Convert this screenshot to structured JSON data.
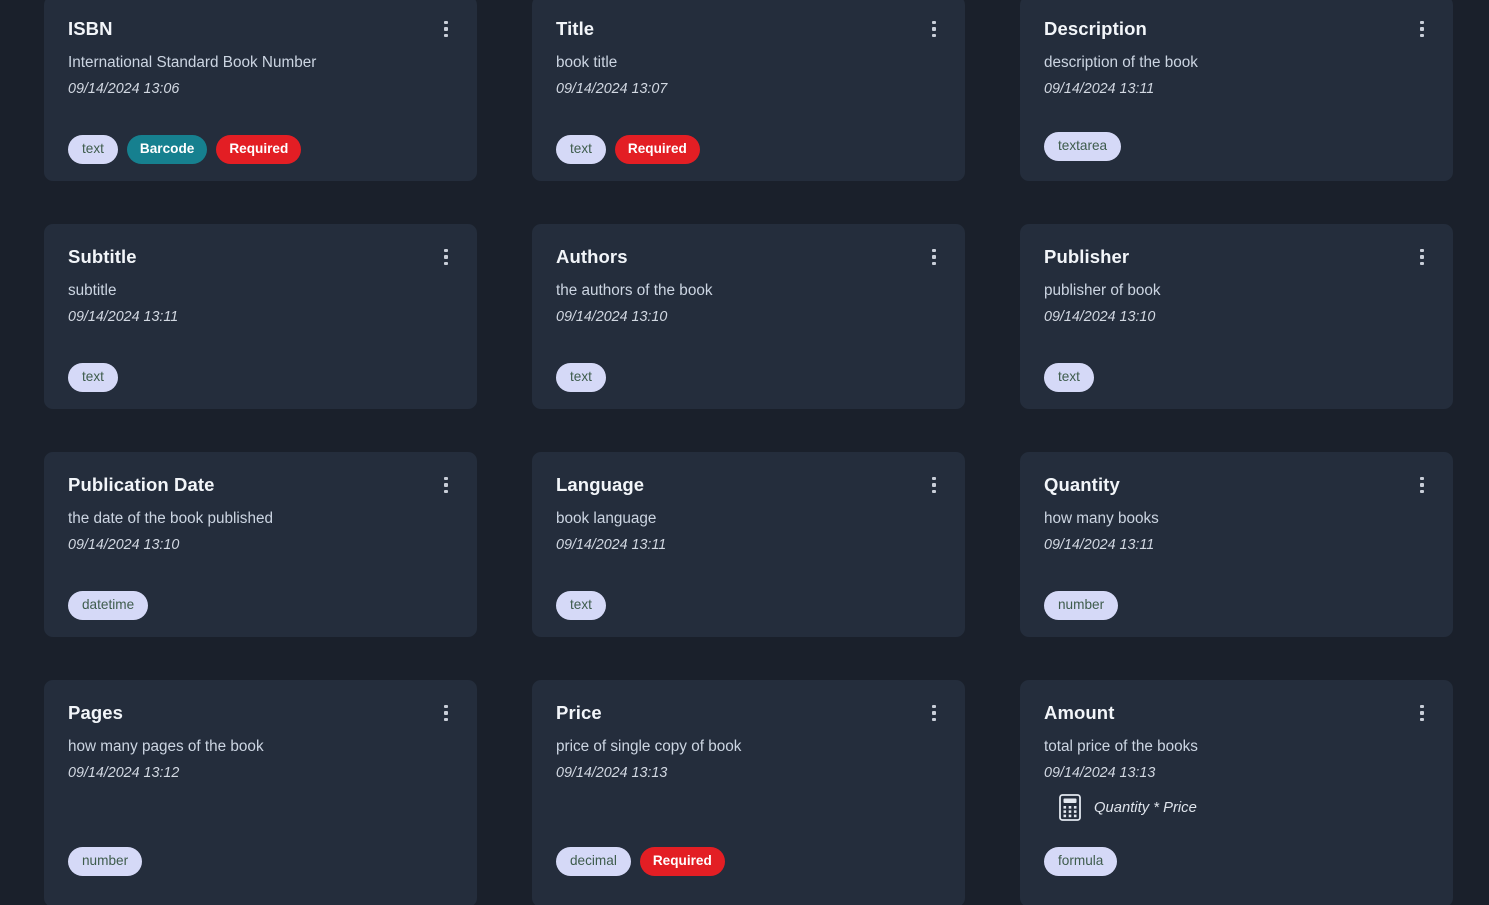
{
  "colors": {
    "page_background": "#1a202b",
    "card_background": "#242d3c",
    "title_text": "#f2f5f9",
    "description_text": "#ccd5e2",
    "timestamp_text": "#d2d8e2",
    "badge_type_bg": "#d5d9f7",
    "badge_type_text": "#3e5c4c",
    "badge_barcode_bg": "#16808f",
    "badge_required_bg": "#e31e24",
    "kebab_dots": "#c9ced8"
  },
  "icons": {
    "kebab": "kebab-menu-icon",
    "calculator": "calculator-icon"
  },
  "cards": [
    {
      "title": "ISBN",
      "description": "International Standard Book Number",
      "timestamp": "09/14/2024 13:06",
      "badges": [
        {
          "label": "text",
          "kind": "type"
        },
        {
          "label": "Barcode",
          "kind": "barcode"
        },
        {
          "label": "Required",
          "kind": "required"
        }
      ]
    },
    {
      "title": "Title",
      "description": "book title",
      "timestamp": "09/14/2024 13:07",
      "badges": [
        {
          "label": "text",
          "kind": "type"
        },
        {
          "label": "Required",
          "kind": "required"
        }
      ]
    },
    {
      "title": "Description",
      "description": "description of the book",
      "timestamp": "09/14/2024 13:11",
      "badges": [
        {
          "label": "textarea",
          "kind": "type"
        }
      ]
    },
    {
      "title": "Subtitle",
      "description": "subtitle",
      "timestamp": "09/14/2024 13:11",
      "badges": [
        {
          "label": "text",
          "kind": "type"
        }
      ]
    },
    {
      "title": "Authors",
      "description": "the authors of the book",
      "timestamp": "09/14/2024 13:10",
      "badges": [
        {
          "label": "text",
          "kind": "type"
        }
      ]
    },
    {
      "title": "Publisher",
      "description": "publisher of book",
      "timestamp": "09/14/2024 13:10",
      "badges": [
        {
          "label": "text",
          "kind": "type"
        }
      ]
    },
    {
      "title": "Publication Date",
      "description": "the date of the book published",
      "timestamp": "09/14/2024 13:10",
      "badges": [
        {
          "label": "datetime",
          "kind": "type"
        }
      ]
    },
    {
      "title": "Language",
      "description": "book language",
      "timestamp": "09/14/2024 13:11",
      "badges": [
        {
          "label": "text",
          "kind": "type"
        }
      ]
    },
    {
      "title": "Quantity",
      "description": "how many books",
      "timestamp": "09/14/2024 13:11",
      "badges": [
        {
          "label": "number",
          "kind": "type"
        }
      ]
    },
    {
      "title": "Pages",
      "description": "how many pages of the book",
      "timestamp": "09/14/2024 13:12",
      "badges": [
        {
          "label": "number",
          "kind": "type"
        }
      ]
    },
    {
      "title": "Price",
      "description": "price of single copy of book",
      "timestamp": "09/14/2024 13:13",
      "badges": [
        {
          "label": "decimal",
          "kind": "type"
        },
        {
          "label": "Required",
          "kind": "required"
        }
      ]
    },
    {
      "title": "Amount",
      "description": "total price of the books",
      "timestamp": "09/14/2024 13:13",
      "formula": "Quantity * Price",
      "badges": [
        {
          "label": "formula",
          "kind": "type"
        }
      ]
    }
  ]
}
